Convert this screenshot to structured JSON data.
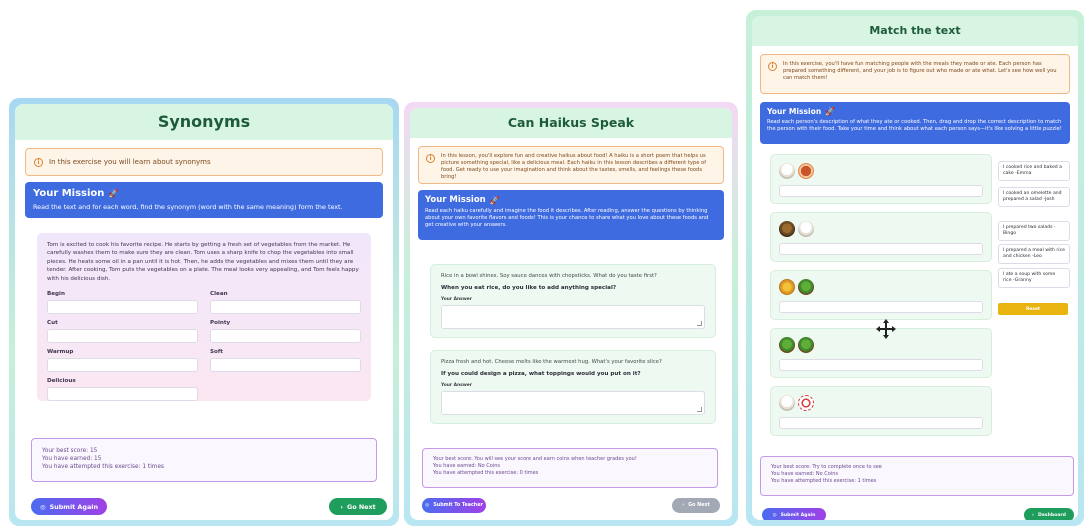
{
  "synonyms": {
    "title": "Synonyms",
    "info": "In this exercise you will learn about synonyms",
    "mission_title": "Your Mission",
    "mission_text": "Read the text and for each word, find the synonym (word with the same meaning) form the text.",
    "passage": "Tom is excited to cook his favorite recipe. He starts by getting a fresh set of vegetables from the market. He carefully washes them to make sure they are clean. Tom uses a sharp knife to chop the vegetables into small pieces. He heats some oil in a pan until it is hot. Then, he adds the vegetables and mixes them until they are tender. After cooking, Tom puts the vegetables on a plate. The meal looks very appealing, and Tom feels happy with his delicious dish.",
    "fields": [
      {
        "label": "Begin"
      },
      {
        "label": "Clean"
      },
      {
        "label": "Cut"
      },
      {
        "label": "Pointy"
      },
      {
        "label": "Warmup"
      },
      {
        "label": "Soft"
      },
      {
        "label": "Delicious"
      }
    ],
    "score": {
      "best": "Your best score: 15",
      "earned": "You have earned: 15",
      "attempts": "You have attempted this exercise: 1 times"
    },
    "submit_label": "Submit Again",
    "next_label": "Go Next"
  },
  "haikus": {
    "title": "Can Haikus Speak",
    "info": "In this lesson, you'll explore fun and creative haikus about food! A haiku is a short poem that helps us picture something special, like a delicious meal. Each haiku in this lesson describes a different type of food. Get ready to use your imagination and think about the tastes, smells, and feelings these foods bring!",
    "mission_title": "Your Mission",
    "mission_text": "Read each haiku carefully and imagine the food it describes. After reading, answer the questions by thinking about your own favorite flavors and foods! This is your chance to share what you love about these foods and get creative with your answers.",
    "questions": [
      {
        "poem": "Rice in a bowl shines. Soy sauce dances with chopsticks. What do you taste first?",
        "ask": "When you eat rice, do you like to add anything special?",
        "answer_label": "Your Answer"
      },
      {
        "poem": "Pizza fresh and hot. Cheese melts like the warmest hug. What's your favorite slice?",
        "ask": "If you could design a pizza, what toppings would you put on it?",
        "answer_label": "Your Answer"
      }
    ],
    "score": {
      "best": "Your best score: You will see your score and earn coins when teacher grades you!",
      "earned": "You have earned: No Coins",
      "attempts": "You have attempted this exercise: 0 times"
    },
    "submit_label": "Submit To Teacher",
    "next_label": "Go Next"
  },
  "match": {
    "title": "Match the text",
    "info": "In this exercise, you'll have fun matching people with the meals they made or ate. Each person has prepared something different, and your job is to figure out who made or ate what. Let's see how well you can match them!",
    "mission_title": "Your Mission",
    "mission_text": "Read each person's description of what they ate or cooked. Then, drag and drop the correct description to match the person with their food. Take your time and think about what each person says—it's like solving a little puzzle!",
    "slots": [
      {
        "foods": [
          "bowl-rice",
          "cake"
        ]
      },
      {
        "foods": [
          "soup",
          "bowl-rice"
        ]
      },
      {
        "foods": [
          "omelette",
          "salad"
        ]
      },
      {
        "foods": [
          "salad",
          "salad"
        ]
      },
      {
        "foods": [
          "bowl-rice",
          "chicken"
        ]
      }
    ],
    "options": [
      "I cooked rice and baked a cake -Emma",
      "I cooked an omelette and prepared a salad -Josh",
      "I prepared two salads -Bingo",
      "I prepared a meal with rice and chicken -Leo",
      "I ate a soup with some rice -Granny"
    ],
    "reset_label": "Reset",
    "score": {
      "best": "Your best score: Try to complete once to see",
      "earned": "You have earned: No Coins",
      "attempts": "You have attempted this exercise: 1 times"
    },
    "submit_label": "Submit Again",
    "dashboard_label": "Dashboard"
  },
  "colors": {
    "accent_blue": "#3f6be0",
    "go_green": "#1f9d5c",
    "reset_yellow": "#e9b310",
    "info_orange": "#f0b985"
  }
}
